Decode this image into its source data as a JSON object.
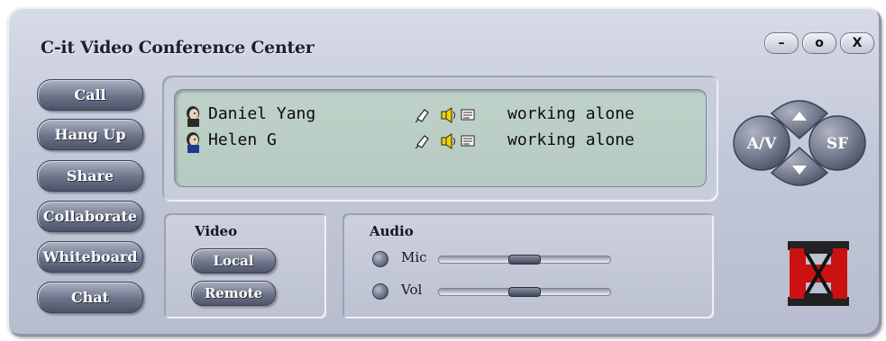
{
  "window": {
    "title": "C-it Video Conference Center",
    "controls": {
      "minimize": "–",
      "restore": "o",
      "close": "X"
    }
  },
  "nav": {
    "call": "Call",
    "hangup": "Hang Up",
    "share": "Share",
    "collaborate": "Collaborate",
    "whiteboard": "Whiteboard",
    "chat": "Chat"
  },
  "participants": [
    {
      "name": "Daniel Yang",
      "status": "working alone",
      "icons": [
        "phone-icon",
        "speaker-icon",
        "video-icon"
      ]
    },
    {
      "name": "Helen G",
      "status": "working alone",
      "icons": [
        "phone-icon",
        "speaker-icon",
        "video-icon"
      ]
    }
  ],
  "video": {
    "title": "Video",
    "local": "Local",
    "remote": "Remote"
  },
  "audio": {
    "title": "Audio",
    "mic_label": "Mic",
    "vol_label": "Vol",
    "mic_level": 0.5,
    "vol_level": 0.5
  },
  "dpad": {
    "left": "A/V",
    "right": "SF"
  },
  "colors": {
    "window": "#c3c8d8",
    "button": "#6c7388",
    "list_bg": "#bfd2c9",
    "logo_red": "#cc1111"
  }
}
